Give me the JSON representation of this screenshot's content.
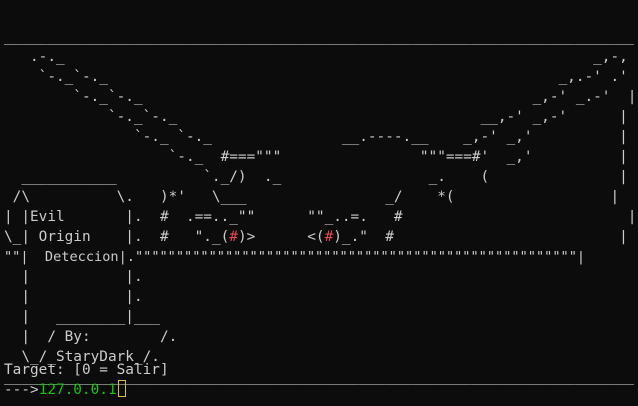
{
  "banner": {
    "lines": [
      "___________________________________________________________________________",
      "   .-._                                                             _,-,  |",
      "    `-._`-._                                                    _,.-' .' |",
      "        `-._`-._                                             _,-' _.-'  |",
      "            `-._`-._                                   __,-' _,-'      |",
      "               `-._ `-._               __.----.__    _,-' _,'          |",
      "                   `-._  #===\"\"\"                \"\"\"===#'  _,'          |",
      "  ___________          `._/)  ._                 _.    (               |",
      " /\\          \\.   )*'   \\___                _/    *(                  |",
      "| |Evil       |.  #  .==.._\"\"      \"\"_..=.   #                          |",
      "\\_| Origin    |.  #   \"._(#)>      <(#)_.\"  #                          |",
      "\"\"|  Deteccion|.\"\"\"\"\"\"\"\"\"\"\"\"\"\"\"\"\"\"\"\"\"\"\"\"\"\"\"\"\"\"\"\"\"\"\"\"\"\"\"\"\"\"\"\"\"\"\"\"\"\"\"\"\"\"|",
      "  |           |.                                                         |",
      "  |           |.                                                         |",
      "  |   ________|___                                                       |",
      "  |  / By:        /.                                                     |",
      "  \\_/_StaryDark_/.                                                       |",
      "___________________________________________________________________________|"
    ],
    "eye_left_prefix": "\\_| Origin    |.  #   \"._(",
    "eye_left": "#",
    "eye_middle": ")>      <(",
    "eye_right": "#",
    "eye_suffix": ")_.\"  #                          |"
  },
  "prompt": {
    "target_line": "Target: [0 = Salir]",
    "arrow": "--->",
    "input_value": "127.0.0.1"
  },
  "colors": {
    "background": "#0c0c0c",
    "text": "#cccccc",
    "eyes": "#e74856",
    "input": "#16c60c",
    "cursor": "#d7c04a"
  }
}
